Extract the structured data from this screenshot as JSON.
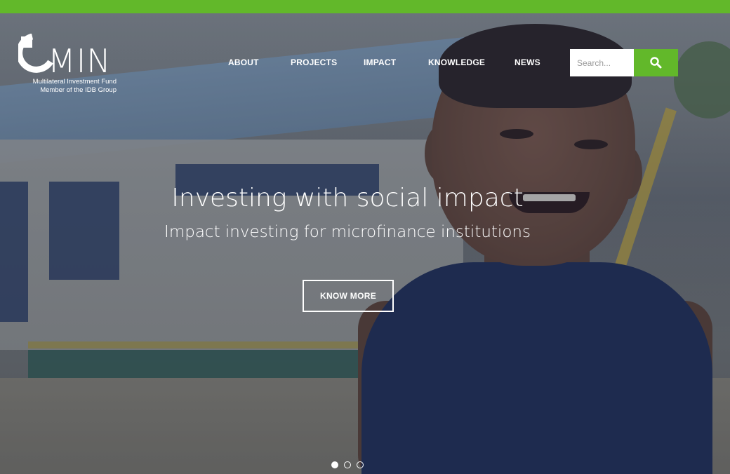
{
  "logo": {
    "text": "MIN",
    "line1": "Multilateral Investment Fund",
    "line2": "Member of the IDB Group"
  },
  "nav": {
    "items": [
      {
        "label": "ABOUT"
      },
      {
        "label": "PROJECTS"
      },
      {
        "label": "IMPACT"
      },
      {
        "label": "KNOWLEDGE"
      },
      {
        "label": "NEWS"
      }
    ]
  },
  "search": {
    "placeholder": "Search..."
  },
  "hero": {
    "title": "Investing with social impact",
    "subtitle": "Impact investing for microfinance institutions",
    "cta_label": "KNOW MORE"
  },
  "carousel": {
    "slide_count": 3,
    "active_index": 0
  },
  "colors": {
    "accent": "#62b82a",
    "overlay": "#1e2d55",
    "text": "#ffffff"
  },
  "icons": {
    "search": "magnifier-icon",
    "logo_mark": "fomin-logo-mark"
  }
}
